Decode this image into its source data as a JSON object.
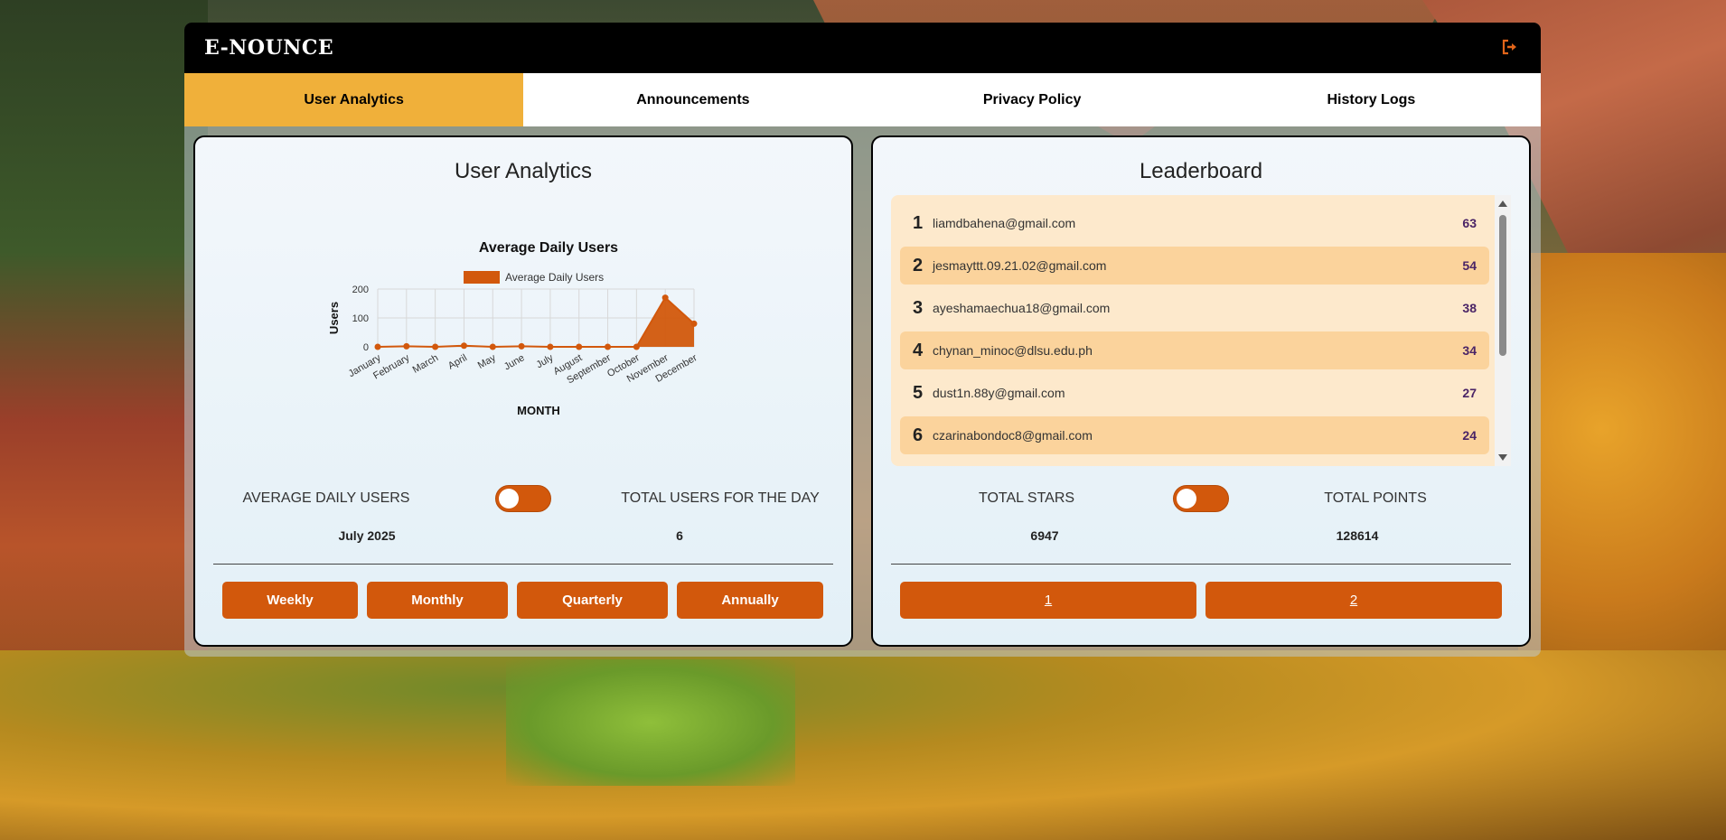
{
  "app": {
    "brand": "E-NOUNCE",
    "logout_icon": "logout-icon"
  },
  "tabs": [
    {
      "label": "User Analytics",
      "active": true
    },
    {
      "label": "Announcements",
      "active": false
    },
    {
      "label": "Privacy Policy",
      "active": false
    },
    {
      "label": "History Logs",
      "active": false
    }
  ],
  "analytics": {
    "title": "User Analytics",
    "toggle_left": "AVERAGE DAILY USERS",
    "toggle_right": "TOTAL USERS FOR THE DAY",
    "value_left": "July 2025",
    "value_right": "6",
    "buttons": [
      "Weekly",
      "Monthly",
      "Quarterly",
      "Annually"
    ]
  },
  "chart_data": {
    "type": "area",
    "title": "Average Daily Users",
    "legend": [
      "Average Daily Users"
    ],
    "xlabel": "MONTH",
    "ylabel": "Users",
    "categories": [
      "January",
      "February",
      "March",
      "April",
      "May",
      "June",
      "July",
      "August",
      "September",
      "October",
      "November",
      "December"
    ],
    "series": [
      {
        "name": "Average Daily Users",
        "values": [
          0,
          2,
          0,
          4,
          0,
          2,
          0,
          0,
          0,
          0,
          170,
          80
        ]
      }
    ],
    "ylim": [
      0,
      200
    ],
    "yticks": [
      "0",
      "100",
      "200"
    ],
    "grid": true,
    "legend_position": "top",
    "color": "#d2580c"
  },
  "leaderboard": {
    "title": "Leaderboard",
    "rows": [
      {
        "rank": "1",
        "email": "liamdbahena@gmail.com",
        "score": "63"
      },
      {
        "rank": "2",
        "email": "jesmayttt.09.21.02@gmail.com",
        "score": "54"
      },
      {
        "rank": "3",
        "email": "ayeshamaechua18@gmail.com",
        "score": "38"
      },
      {
        "rank": "4",
        "email": "chynan_minoc@dlsu.edu.ph",
        "score": "34"
      },
      {
        "rank": "5",
        "email": "dust1n.88y@gmail.com",
        "score": "27"
      },
      {
        "rank": "6",
        "email": "czarinabondoc8@gmail.com",
        "score": "24"
      }
    ],
    "toggle_left": "TOTAL STARS",
    "toggle_right": "TOTAL POINTS",
    "value_left": "6947",
    "value_right": "128614",
    "pages": [
      "1",
      "2"
    ]
  }
}
